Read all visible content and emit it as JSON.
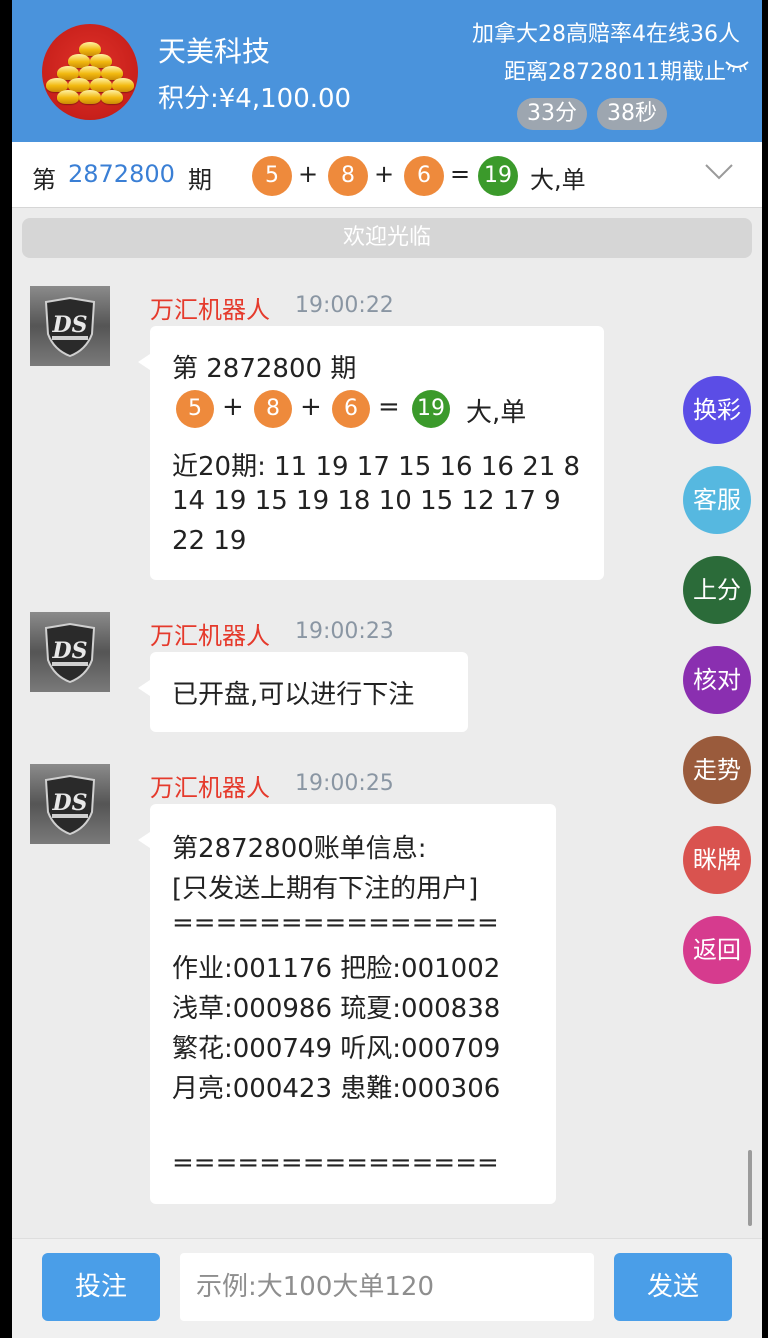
{
  "header": {
    "shop_name": "天美科技",
    "points": "积分:¥4,100.00",
    "room_info": "加拿大28高赔率4在线36人",
    "deadline": "距离28728011期截止",
    "timer_min": "33分",
    "timer_sec": "38秒"
  },
  "draw": {
    "prefix": "第",
    "issue": "2872800",
    "suffix": "期",
    "balls": [
      "5",
      "8",
      "6"
    ],
    "plus": "+",
    "equals": "=",
    "sum": "19",
    "result": "大,单"
  },
  "welcome": "欢迎光临",
  "messages": [
    {
      "sender": "万汇机器人",
      "time": "19:00:22",
      "title": "第 2872800 期",
      "balls": [
        "5",
        "8",
        "6"
      ],
      "sum": "19",
      "result": "大,单",
      "lines": [
        "近20期: 11 19 17 15 16 16 21 8",
        "14 19 15 19 18 10 15 12 17 9",
        "22 19"
      ]
    },
    {
      "sender": "万汇机器人",
      "time": "19:00:23",
      "text": "已开盘,可以进行下注"
    },
    {
      "sender": "万汇机器人",
      "time": "19:00:25",
      "lines": [
        "第2872800账单信息:",
        "[只发送上期有下注的用户]",
        "===============",
        "作业:001176 把脸:001002",
        "浅草:000986 琉夏:000838",
        "繁花:000749 听风:000709",
        "月亮:000423 患難:000306",
        "",
        "==============="
      ]
    }
  ],
  "side_buttons": [
    {
      "label": "换彩",
      "color": "#5b4de6"
    },
    {
      "label": "客服",
      "color": "#56b8e0"
    },
    {
      "label": "上分",
      "color": "#2b6b39"
    },
    {
      "label": "核对",
      "color": "#8a2fb0"
    },
    {
      "label": "走势",
      "color": "#9a5b3c"
    },
    {
      "label": "眯牌",
      "color": "#d9534f"
    },
    {
      "label": "返回",
      "color": "#d63b8e"
    }
  ],
  "footer": {
    "bet_label": "投注",
    "input_placeholder": "示例:大100大单120",
    "send_label": "发送"
  },
  "icons": [
    "gold-ingot-logo-icon",
    "eye-closed-icon",
    "chevron-down-icon",
    "ds-shield-avatar-icon"
  ]
}
